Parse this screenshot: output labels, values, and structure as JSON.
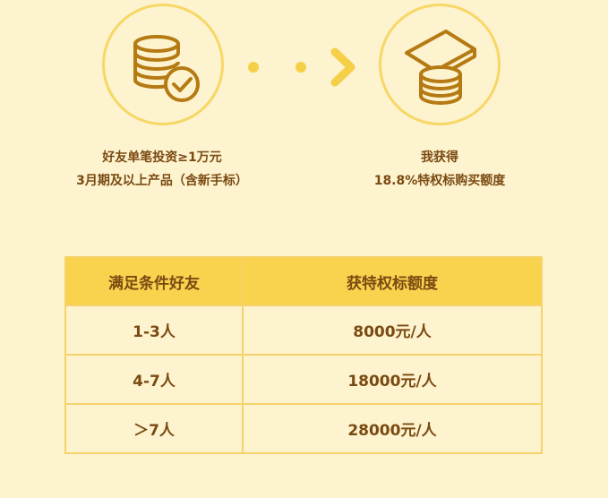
{
  "steps": [
    {
      "icon": "coins-check-icon",
      "caption_line1": "好友单笔投资≥1万元",
      "caption_line2": "3月期及以上产品（含新手标）"
    },
    {
      "icon": "cash-coins-icon",
      "caption_line1": "我获得",
      "caption_line2": "18.8%特权标购买额度"
    }
  ],
  "table": {
    "headers": [
      "满足条件好友",
      "获特权标额度"
    ],
    "rows": [
      [
        "1-3人",
        "8000元/人"
      ],
      [
        "4-7人",
        "18000元/人"
      ],
      [
        "＞7人",
        "28000元/人"
      ]
    ]
  },
  "colors": {
    "background": "#fdf3cf",
    "accent": "#f9d24e",
    "icon_stroke": "#b57a12",
    "text": "#7a4a12"
  }
}
